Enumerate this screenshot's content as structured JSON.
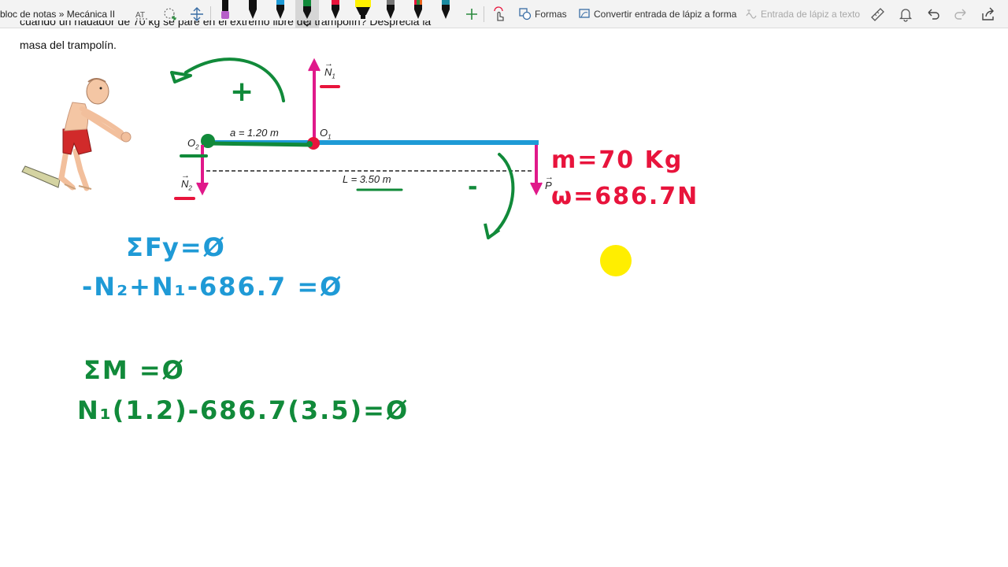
{
  "toolbar": {
    "breadcrumb": "bloc de notas » Mecánica II",
    "shapes_label": "Formas",
    "convert_label": "Convertir entrada de lápiz a forma",
    "ink_to_text_label": "Entrada de lápiz a texto",
    "pens": [
      {
        "name": "pen-purple",
        "color": "#b65fc9"
      },
      {
        "name": "pen-black",
        "color": "#111111"
      },
      {
        "name": "pen-blue",
        "color": "#1e9ad6"
      },
      {
        "name": "pen-green",
        "color": "#118a3a"
      },
      {
        "name": "pen-red",
        "color": "#e8143c"
      },
      {
        "name": "highlighter-yellow",
        "color": "#fff200"
      },
      {
        "name": "pen-gray",
        "color": "#777777"
      },
      {
        "name": "pen-orange",
        "color": "#e8631c"
      },
      {
        "name": "pen-dark",
        "color": "#222222"
      },
      {
        "name": "pen-teal",
        "color": "#1a8aa0"
      }
    ]
  },
  "problem": {
    "line1": "cuando un nadador de 70 kg se pare en el extremo libre del trampolín? Desprecia la",
    "line2": "masa del trampolín."
  },
  "diagram": {
    "a_label": "a = 1.20 m",
    "L_label": "L = 3.50 m",
    "O1": "O",
    "O1_sub": "1",
    "O2": "O",
    "O2_sub": "2",
    "N1": "N",
    "N1_sub": "1",
    "N2": "N",
    "N2_sub": "2",
    "P": "P"
  },
  "handwriting": {
    "mass": "m=70 Kg",
    "weight": "ω=686.7N",
    "plus": "+",
    "minus": "-",
    "sum_fy": "ΣFy=Ø",
    "eq1": "-N₂+N₁-686.7 =Ø",
    "sum_m": "ΣM =Ø",
    "eq2": "N₁(1.2)-686.7(3.5)=Ø"
  },
  "colors": {
    "beam": "#1e9ad6",
    "force": "#e0198a",
    "red_ink": "#e8143c",
    "blue_ink": "#1f9ad6",
    "green_ink": "#118a3a",
    "pointer": "#ffee00"
  }
}
